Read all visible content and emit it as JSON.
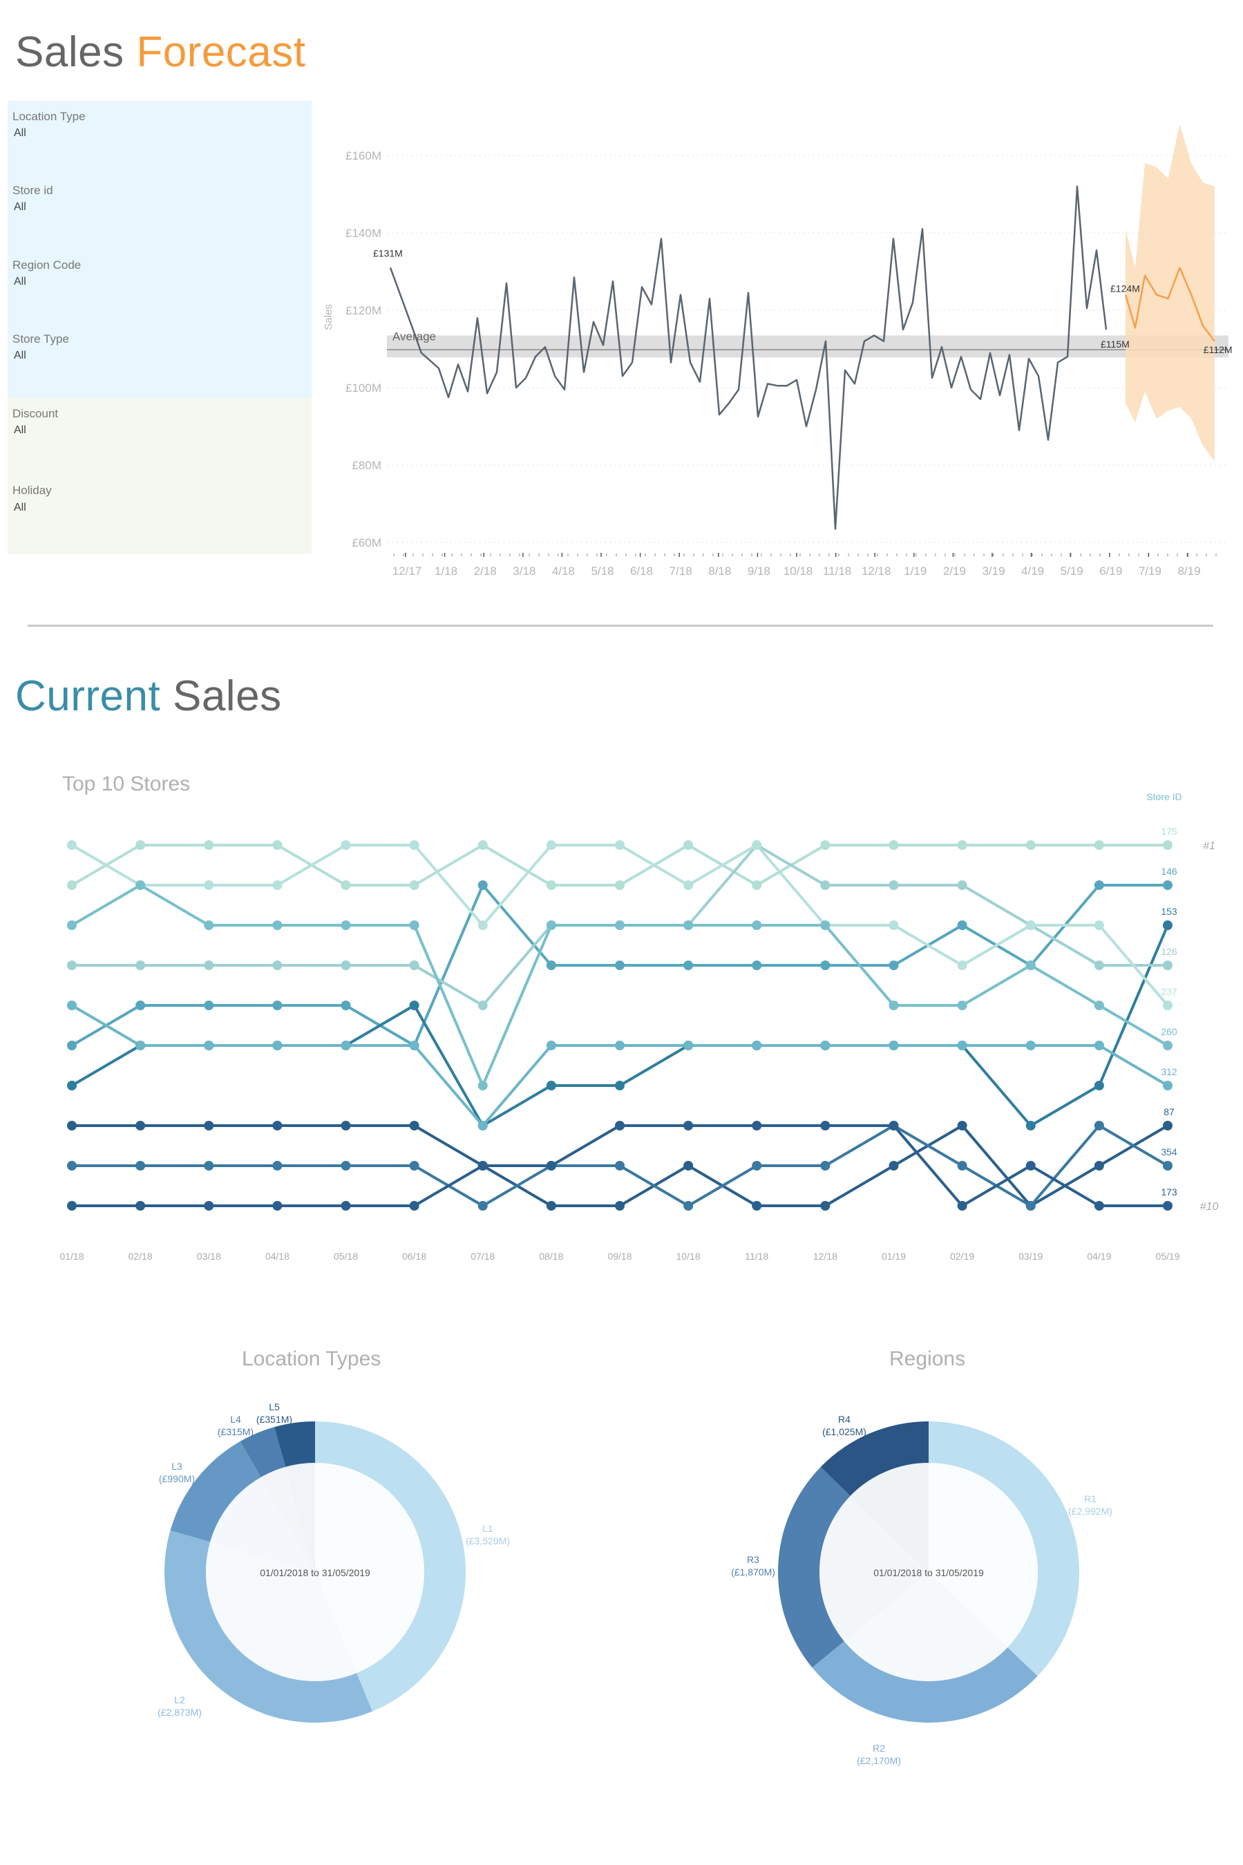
{
  "header": {
    "title_part1": "Sales ",
    "title_part2": "Forecast",
    "accent_orange": "#f59b3c"
  },
  "filters": [
    {
      "label": "Location Type",
      "value": "All"
    },
    {
      "label": "Store id",
      "value": "All"
    },
    {
      "label": "Region Code",
      "value": "All"
    },
    {
      "label": "Store Type",
      "value": "All"
    },
    {
      "label": "Discount",
      "value": "All"
    },
    {
      "label": "Holiday",
      "value": "All"
    }
  ],
  "section2": {
    "title_part1": "Current",
    "title_part2": " Sales",
    "accent_teal": "#3a8da8"
  },
  "chart_data": [
    {
      "type": "line",
      "ylabel": "Sales",
      "ylim": [
        60,
        160
      ],
      "y_ticks": [
        "£160M",
        "£140M",
        "£120M",
        "£100M",
        "£80M",
        "£60M"
      ],
      "x_ticks": [
        "12/17",
        "1/18",
        "2/18",
        "3/18",
        "4/18",
        "5/18",
        "6/18",
        "7/18",
        "8/18",
        "9/18",
        "10/18",
        "11/18",
        "12/18",
        "1/19",
        "2/19",
        "3/19",
        "4/19",
        "5/19",
        "6/19",
        "7/19",
        "8/19"
      ],
      "reference_line": {
        "label": "Average",
        "value": 109.8,
        "band": [
          107.8,
          113.5
        ]
      },
      "annotations": [
        {
          "text": "£131M",
          "point": "actual_first"
        },
        {
          "text": "£115M",
          "point": "actual_last"
        },
        {
          "text": "£124M",
          "point": "forecast_first"
        },
        {
          "text": "£112M",
          "point": "forecast_last"
        }
      ],
      "series": [
        {
          "name": "Actual",
          "color": "#5a6570",
          "x_weeks": [
            0.0,
            1.1,
            1.6,
            2.5,
            3.0,
            3.5,
            4.0,
            4.5,
            5.0,
            5.5,
            6.0,
            6.5,
            7.0,
            7.5,
            8.0,
            8.5,
            9.0,
            9.5,
            10.0,
            10.5,
            11.0,
            11.5,
            12.0,
            12.5,
            13.0,
            13.5,
            14.0,
            14.5,
            15.0,
            15.5,
            16.0,
            16.5,
            17.0,
            17.5,
            18.0,
            18.5,
            19.0,
            19.5,
            20.0,
            20.5,
            21.0,
            21.5,
            22.0,
            22.5,
            23.0,
            23.5,
            24.0,
            24.5,
            25.0,
            25.5,
            26.0,
            26.5,
            27.0,
            27.5,
            28.0,
            28.5,
            29.0,
            29.5,
            30.0,
            30.5,
            31.0,
            31.5,
            32.0,
            32.5,
            33.0,
            33.5,
            34.0,
            34.5,
            35.0,
            35.5,
            36.0,
            36.5,
            37.0,
            37.5
          ],
          "values": [
            131,
            116,
            109,
            105,
            97.5,
            106,
            99,
            118,
            98.5,
            104,
            127,
            100,
            102.5,
            108,
            110.5,
            103,
            99.5,
            128.5,
            104,
            117,
            111,
            127.5,
            103,
            106.5,
            126,
            121.5,
            138.5,
            106.5,
            124,
            106.5,
            101.5,
            123,
            93,
            96,
            99.5,
            124.5,
            92.5,
            101,
            100.5,
            100.5,
            102,
            90,
            99.5,
            112,
            63.5,
            104.5,
            101,
            112,
            113.5,
            112,
            138.5,
            115,
            122,
            141,
            102.5,
            110.5,
            100,
            108,
            99.5,
            97,
            109,
            98,
            108.5,
            89,
            107.5,
            103,
            86.5,
            106.5,
            108,
            152,
            120.5,
            135.5,
            115
          ]
        },
        {
          "name": "Forecast",
          "color": "#f5a04a",
          "band_color": "#fcdcb8",
          "x_weeks": [
            38.0,
            38.5,
            39.0,
            39.6,
            40.2,
            40.8,
            41.4,
            42.0,
            42.6
          ],
          "values": [
            124,
            115.5,
            129,
            124,
            123,
            131,
            124,
            116,
            112
          ],
          "upper": [
            141,
            131,
            158,
            157,
            154,
            168,
            158,
            153,
            152
          ],
          "lower": [
            96,
            91,
            99,
            92,
            94,
            95,
            92,
            85,
            81
          ]
        }
      ]
    },
    {
      "type": "line",
      "title": "Top 10 Stores",
      "legend_title": "Store ID",
      "x": [
        "01/18",
        "02/18",
        "03/18",
        "04/18",
        "05/18",
        "06/18",
        "07/18",
        "08/18",
        "09/18",
        "10/18",
        "11/18",
        "12/18",
        "01/19",
        "02/19",
        "03/19",
        "04/19",
        "05/19"
      ],
      "rank_labels": [
        "#1",
        "#10"
      ],
      "series": [
        {
          "name": "175",
          "color": "#b2dfd6",
          "ranks": [
            2,
            1,
            1,
            1,
            2,
            2,
            1,
            2,
            2,
            1,
            2,
            1,
            1,
            1,
            1,
            1,
            1
          ]
        },
        {
          "name": "146",
          "color": "#56a7be",
          "ranks": [
            6,
            5,
            5,
            5,
            5,
            6,
            2,
            4,
            4,
            4,
            4,
            4,
            4,
            3,
            4,
            2,
            2
          ]
        },
        {
          "name": "153",
          "color": "#2f7e9f",
          "ranks": [
            7,
            6,
            6,
            6,
            6,
            5,
            8,
            7,
            7,
            6,
            6,
            6,
            6,
            6,
            8,
            7,
            3
          ]
        },
        {
          "name": "126",
          "color": "#9ed0d2",
          "ranks": [
            4,
            4,
            4,
            4,
            4,
            4,
            5,
            3,
            3,
            3,
            1,
            2,
            2,
            2,
            3,
            4,
            4
          ]
        },
        {
          "name": "237",
          "color": "#b6e1dd",
          "ranks": [
            1,
            2,
            2,
            2,
            1,
            1,
            3,
            1,
            1,
            2,
            1,
            3,
            3,
            4,
            3,
            3,
            5
          ]
        },
        {
          "name": "260",
          "color": "#78bfcb",
          "ranks": [
            3,
            2,
            3,
            3,
            3,
            3,
            7,
            3,
            3,
            3,
            3,
            3,
            5,
            5,
            4,
            5,
            6
          ]
        },
        {
          "name": "312",
          "color": "#6bb6c7",
          "ranks": [
            5,
            6,
            6,
            6,
            6,
            6,
            8,
            6,
            6,
            6,
            6,
            6,
            6,
            6,
            6,
            6,
            7
          ]
        },
        {
          "name": "87",
          "color": "#2a5f8c",
          "ranks": [
            8,
            8,
            8,
            8,
            8,
            8,
            9,
            10,
            10,
            9,
            10,
            10,
            9,
            8,
            10,
            9,
            8
          ]
        },
        {
          "name": "354",
          "color": "#3a79a1",
          "ranks": [
            9,
            9,
            9,
            9,
            9,
            9,
            10,
            9,
            9,
            10,
            9,
            9,
            8,
            9,
            10,
            8,
            9
          ]
        },
        {
          "name": "173",
          "color": "#2b5f8e",
          "ranks": [
            10,
            10,
            10,
            10,
            10,
            10,
            9,
            9,
            8,
            8,
            8,
            8,
            8,
            10,
            9,
            10,
            10
          ]
        }
      ]
    },
    {
      "type": "pie",
      "title": "Location Types",
      "center_label": "01/01/2018 to 31/05/2019",
      "slices": [
        {
          "label": "L1",
          "value_label": "(£3,529M)",
          "value": 3529,
          "color": "#bcdff1"
        },
        {
          "label": "L2",
          "value_label": "(£2,873M)",
          "value": 2873,
          "color": "#8dbbde"
        },
        {
          "label": "L3",
          "value_label": "(£990M)",
          "value": 990,
          "color": "#6598c4"
        },
        {
          "label": "L4",
          "value_label": "(£315M)",
          "value": 315,
          "color": "#4d7fb0"
        },
        {
          "label": "L5",
          "value_label": "(£351M)",
          "value": 351,
          "color": "#2a5a8a"
        }
      ]
    },
    {
      "type": "pie",
      "title": "Regions",
      "center_label": "01/01/2018 to 31/05/2019",
      "slices": [
        {
          "label": "R1",
          "value_label": "(£2,992M)",
          "value": 2992,
          "color": "#bcdff1"
        },
        {
          "label": "R2",
          "value_label": "(£2,170M)",
          "value": 2170,
          "color": "#80b0d8"
        },
        {
          "label": "R3",
          "value_label": "(£1,870M)",
          "value": 1870,
          "color": "#4f80b0"
        },
        {
          "label": "R4",
          "value_label": "(£1,025M)",
          "value": 1025,
          "color": "#2a5585"
        }
      ]
    }
  ]
}
